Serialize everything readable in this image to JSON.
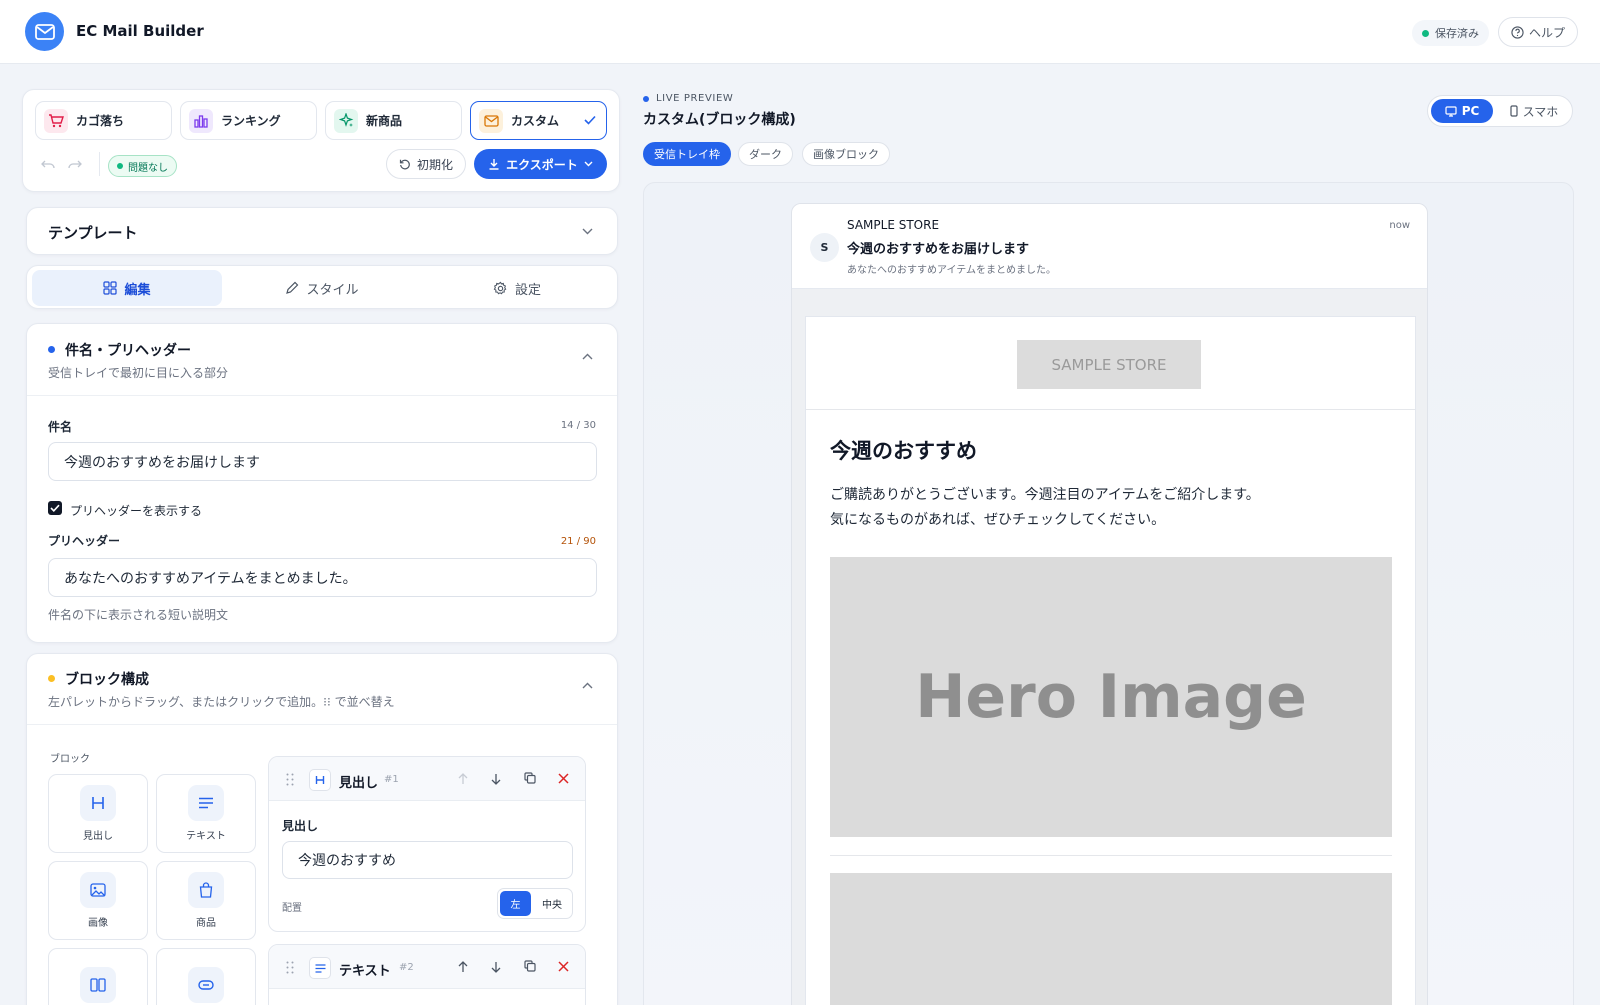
{
  "header": {
    "app_title": "EC Mail Builder",
    "saved_label": "保存済み",
    "help_label": "ヘルプ"
  },
  "colors": {
    "primary": "#2563eb",
    "success": "#10b981",
    "warning": "#fbbf24",
    "danger": "#dc2626"
  },
  "template_tabs": [
    {
      "label": "カゴ落ち",
      "icon": "cart-icon"
    },
    {
      "label": "ランキング",
      "icon": "bar-chart-icon"
    },
    {
      "label": "新商品",
      "icon": "sparkle-icon"
    },
    {
      "label": "カスタム",
      "icon": "mail-icon",
      "selected": true
    }
  ],
  "toolbar": {
    "status_badge": "問題なし",
    "reset_label": "初期化",
    "export_label": "エクスポート"
  },
  "template_section": {
    "title": "テンプレート"
  },
  "mode_tabs": [
    {
      "label": "編集",
      "active": true
    },
    {
      "label": "スタイル"
    },
    {
      "label": "設定"
    }
  ],
  "subject_section": {
    "title": "件名・プリヘッダー",
    "subtitle": "受信トレイで最初に目に入る部分",
    "subject_label": "件名",
    "subject_count": "14 / 30",
    "subject_value": "今週のおすすめをお届けします",
    "show_preheader_label": "プリヘッダーを表示する",
    "show_preheader_checked": true,
    "preheader_label": "プリヘッダー",
    "preheader_count": "21 / 90",
    "preheader_value": "あなたへのおすすめアイテムをまとめました。",
    "preheader_help": "件名の下に表示される短い説明文"
  },
  "blocks_section": {
    "title": "ブロック構成",
    "subtitle": "左パレットからドラッグ、またはクリックで追加。⁝⁝ で並べ替え",
    "palette_title": "ブロック",
    "palette": [
      {
        "label": "見出し",
        "icon": "heading-icon"
      },
      {
        "label": "テキスト",
        "icon": "text-lines-icon"
      },
      {
        "label": "画像",
        "icon": "image-icon"
      },
      {
        "label": "商品",
        "icon": "shopping-bag-icon"
      },
      {
        "label": "",
        "icon": "columns-icon"
      },
      {
        "label": "",
        "icon": "button-icon"
      }
    ],
    "block1": {
      "title": "見出し",
      "index": "#1",
      "field_label": "見出し",
      "field_value": "今週のおすすめ",
      "align_label": "配置",
      "align_options": [
        "左",
        "中央"
      ],
      "align_selected": "左"
    },
    "block2": {
      "title": "テキスト",
      "index": "#2"
    }
  },
  "preview": {
    "live_label": "LIVE PREVIEW",
    "title": "カスタム(ブロック構成)",
    "view_chips": [
      "受信トレイ枠",
      "ダーク",
      "画像ブロック"
    ],
    "device_pc": "PC",
    "device_mobile": "スマホ",
    "inbox": {
      "avatar": "S",
      "sender": "SAMPLE STORE",
      "time": "now",
      "subject": "今週のおすすめをお届けします",
      "preheader": "あなたへのおすすめアイテムをまとめました。"
    },
    "email": {
      "logo": "SAMPLE STORE",
      "heading": "今週のおすすめ",
      "body_line1": "ご購読ありがとうございます。今週注目のアイテムをご紹介します。",
      "body_line2": "気になるものがあれば、ぜひチェックしてください。",
      "hero": "Hero Image"
    }
  }
}
